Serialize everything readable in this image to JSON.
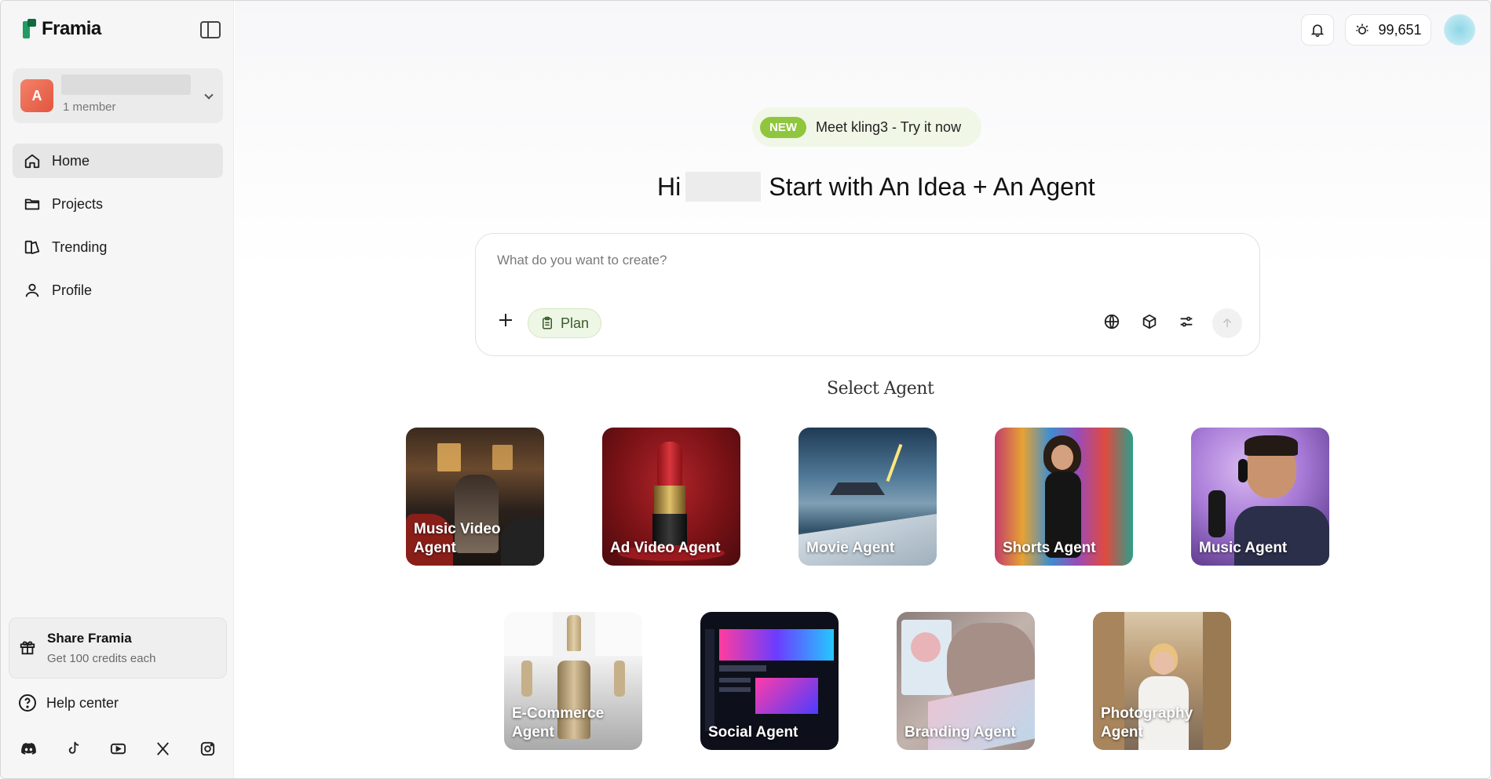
{
  "brand": {
    "name": "Framia",
    "primary_color": "#1f9d63"
  },
  "workspace": {
    "initial": "A",
    "members": "1 member"
  },
  "nav": [
    {
      "label": "Home",
      "icon": "home-icon",
      "active": true
    },
    {
      "label": "Projects",
      "icon": "folder-icon",
      "active": false
    },
    {
      "label": "Trending",
      "icon": "trending-icon",
      "active": false
    },
    {
      "label": "Profile",
      "icon": "user-icon",
      "active": false
    }
  ],
  "share": {
    "title": "Share Framia",
    "subtitle": "Get 100 credits each"
  },
  "help": {
    "label": "Help center"
  },
  "socials": [
    "discord-icon",
    "tiktok-icon",
    "youtube-icon",
    "x-icon",
    "instagram-icon"
  ],
  "topbar": {
    "credits": "99,651"
  },
  "announcement": {
    "badge": "NEW",
    "text": "Meet kling3 - Try it now"
  },
  "greeting": {
    "prefix": "Hi",
    "suffix": "Start with An Idea + An Agent"
  },
  "composer": {
    "placeholder": "What do you want to create?",
    "plan_label": "Plan"
  },
  "agents_title": "Select Agent",
  "agents": [
    {
      "label": "Music Video Agent"
    },
    {
      "label": "Ad Video Agent"
    },
    {
      "label": "Movie Agent"
    },
    {
      "label": "Shorts Agent"
    },
    {
      "label": "Music Agent"
    },
    {
      "label": "E-Commerce Agent"
    },
    {
      "label": "Social Agent"
    },
    {
      "label": "Branding Agent"
    },
    {
      "label": "Photography Agent"
    }
  ]
}
